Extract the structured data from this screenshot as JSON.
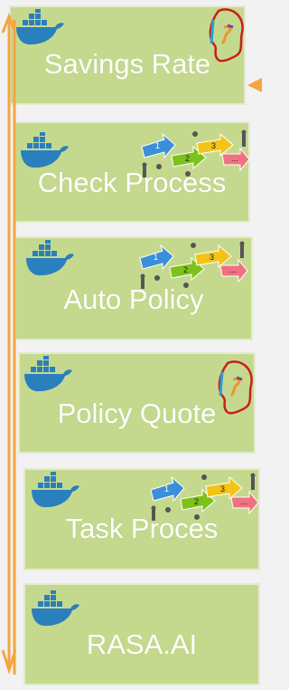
{
  "services": [
    {
      "label": "Savings Rate",
      "icon": "docker-whale-icon",
      "badge": "face-profile-icon"
    },
    {
      "label": "Check Process",
      "icon": "docker-whale-icon",
      "badge": "process-steps-icon",
      "steps": [
        "1",
        "2",
        "3",
        "..."
      ]
    },
    {
      "label": "Auto Policy",
      "icon": "docker-whale-icon",
      "badge": "process-steps-icon",
      "steps": [
        "1",
        "2",
        "3",
        "..."
      ]
    },
    {
      "label": "Policy Quote",
      "icon": "docker-whale-icon",
      "badge": "face-profile-icon"
    },
    {
      "label": "Task Proces",
      "icon": "docker-whale-icon",
      "badge": "process-steps-icon",
      "steps": [
        "1",
        "2",
        "3",
        "..."
      ]
    },
    {
      "label": "RASA.AI",
      "icon": "docker-whale-icon"
    }
  ],
  "colors": {
    "card": "#c5d98e",
    "card_border": "#e3ebd0",
    "text": "#ffffff",
    "arrow": "#f5a540",
    "docker": "#2a7fbd"
  }
}
